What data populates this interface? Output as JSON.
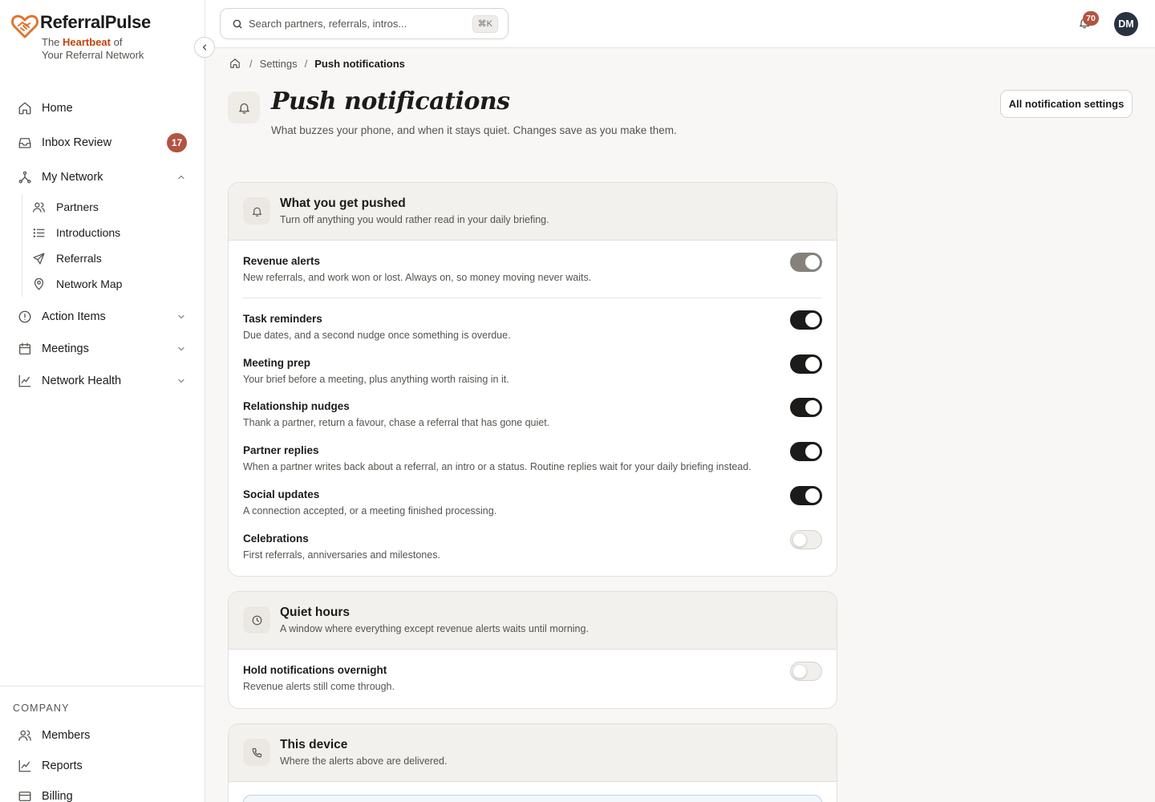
{
  "brand": {
    "name": "ReferralPulse",
    "tagline_pre": "The ",
    "tagline_highlight": "Heartbeat",
    "tagline_post": " of",
    "tagline_line2": "Your Referral Network",
    "accent": "#e0752f"
  },
  "sidebar": {
    "home": "Home",
    "inbox": {
      "label": "Inbox Review",
      "count": "17"
    },
    "my_network": {
      "label": "My Network",
      "items": [
        "Partners",
        "Introductions",
        "Referrals",
        "Network Map"
      ]
    },
    "action_items": "Action Items",
    "meetings": "Meetings",
    "network_health": "Network Health",
    "company": {
      "heading": "COMPANY",
      "members": "Members",
      "reports": "Reports",
      "billing": "Billing"
    }
  },
  "topbar": {
    "search_placeholder": "Search partners, referrals, intros...",
    "shortcut": "⌘K",
    "notification_count": "70",
    "avatar_initials": "DM"
  },
  "breadcrumb": {
    "settings": "Settings",
    "current": "Push notifications"
  },
  "header": {
    "title": "Push notifications",
    "subtitle": "What buzzes your phone, and when it stays quiet. Changes save as you make them.",
    "all_settings_button": "All notification settings"
  },
  "pushed": {
    "title": "What you get pushed",
    "subtitle": "Turn off anything you would rather read in your daily briefing.",
    "items": [
      {
        "title": "Revenue alerts",
        "desc": "New referrals, and work won or lost. Always on, so money moving never waits.",
        "state": "locked"
      },
      {
        "title": "Task reminders",
        "desc": "Due dates, and a second nudge once something is overdue.",
        "state": "on"
      },
      {
        "title": "Meeting prep",
        "desc": "Your brief before a meeting, plus anything worth raising in it.",
        "state": "on"
      },
      {
        "title": "Relationship nudges",
        "desc": "Thank a partner, return a favour, chase a referral that has gone quiet.",
        "state": "on"
      },
      {
        "title": "Partner replies",
        "desc": "When a partner writes back about a referral, an intro or a status. Routine replies wait for your daily briefing instead.",
        "state": "on"
      },
      {
        "title": "Social updates",
        "desc": "A connection accepted, or a meeting finished processing.",
        "state": "on"
      },
      {
        "title": "Celebrations",
        "desc": "First referrals, anniversaries and milestones.",
        "state": "off"
      }
    ]
  },
  "quiet_hours": {
    "title": "Quiet hours",
    "subtitle": "A window where everything except revenue alerts waits until morning.",
    "item": {
      "title": "Hold notifications overnight",
      "desc": "Revenue alerts still come through.",
      "state": "off"
    }
  },
  "device": {
    "title": "This device",
    "subtitle": "Where the alerts above are delivered."
  }
}
